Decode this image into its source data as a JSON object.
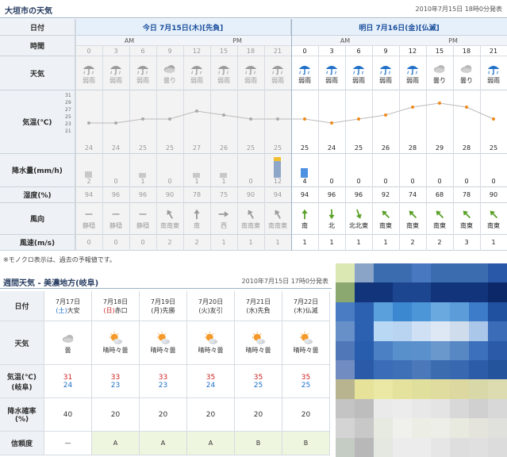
{
  "header": {
    "title": "大垣市の天気",
    "published": "2010年7月15日 18時0分発表"
  },
  "grid": {
    "labels": {
      "date": "日付",
      "time": "時間",
      "weather": "天気",
      "temp": "気温(℃)",
      "precip": "降水量(mm/h)",
      "humidity": "湿度(%)",
      "wind_dir": "風向",
      "wind_speed": "風速(m/s)"
    },
    "today_label": "今日 7月15日(木)[先負]",
    "tomorrow_label": "明日 7月16日(金)[仏滅]",
    "am": "AM",
    "pm": "PM",
    "temp_axis": [
      "31",
      "29",
      "27",
      "25",
      "23",
      "21"
    ],
    "hours": [
      "0",
      "3",
      "6",
      "9",
      "12",
      "15",
      "18",
      "21",
      "0",
      "3",
      "6",
      "9",
      "12",
      "15",
      "18",
      "21"
    ],
    "weather": [
      "弱雨",
      "弱雨",
      "弱雨",
      "曇り",
      "弱雨",
      "弱雨",
      "弱雨",
      "弱雨",
      "弱雨",
      "弱雨",
      "弱雨",
      "弱雨",
      "弱雨",
      "曇り",
      "曇り",
      "弱雨"
    ],
    "temps": [
      "24",
      "24",
      "25",
      "25",
      "27",
      "26",
      "25",
      "25",
      "25",
      "24",
      "25",
      "26",
      "28",
      "29",
      "28",
      "25"
    ],
    "precip": [
      "2",
      "0",
      "1",
      "0",
      "1",
      "1",
      "0",
      "12",
      "4",
      "0",
      "0",
      "0",
      "0",
      "0",
      "0",
      "0"
    ],
    "humidity": [
      "94",
      "96",
      "96",
      "90",
      "78",
      "75",
      "90",
      "94",
      "94",
      "96",
      "96",
      "92",
      "74",
      "68",
      "78",
      "90"
    ],
    "wind_dir": [
      "静穏",
      "静穏",
      "静穏",
      "南南東",
      "南",
      "西",
      "南南東",
      "南南東",
      "南",
      "北",
      "北北東",
      "南東",
      "南東",
      "南東",
      "南東",
      "南東"
    ],
    "wind_speed": [
      "0",
      "0",
      "0",
      "2",
      "2",
      "1",
      "1",
      "1",
      "1",
      "1",
      "1",
      "1",
      "2",
      "2",
      "3",
      "1"
    ],
    "note": "※モノクロ表示は、過去の予報値です。",
    "colors": {
      "past_icon": "#9a9a9a",
      "rain_icon": "#1f6fc8",
      "temp_line": "#f08a1c",
      "precip_bar": "#4d8fe0",
      "precip_peak": "#f0c030"
    }
  },
  "weekly": {
    "title": "週間天気 - 美濃地方(岐阜)",
    "published": "2010年7月15日 17時0分発表",
    "labels": {
      "date": "日付",
      "weather": "天気",
      "temp": "気温(℃)",
      "temp_sub": "(岐阜)",
      "precip": "降水確率",
      "precip_sub": "(%)",
      "reliability": "信頼度"
    },
    "days": [
      {
        "date": "7月17日",
        "wd": "(土)",
        "rokuyo": "大安",
        "weather": "曇",
        "hi": "31",
        "lo": "24",
        "pop": "40",
        "rel": "—"
      },
      {
        "date": "7月18日",
        "wd": "(日)",
        "rokuyo": "赤口",
        "weather": "晴時々曇",
        "hi": "33",
        "lo": "23",
        "pop": "20",
        "rel": "A"
      },
      {
        "date": "7月19日",
        "wd": "(月)",
        "rokuyo": "先勝",
        "weather": "晴時々曇",
        "hi": "33",
        "lo": "23",
        "pop": "20",
        "rel": "A"
      },
      {
        "date": "7月20日",
        "wd": "(火)",
        "rokuyo": "友引",
        "weather": "晴時々曇",
        "hi": "35",
        "lo": "24",
        "pop": "20",
        "rel": "A"
      },
      {
        "date": "7月21日",
        "wd": "(水)",
        "rokuyo": "先負",
        "weather": "晴時々曇",
        "hi": "35",
        "lo": "25",
        "pop": "20",
        "rel": "B"
      },
      {
        "date": "7月22日",
        "wd": "(木)",
        "rokuyo": "仏滅",
        "weather": "晴時々曇",
        "hi": "35",
        "lo": "25",
        "pop": "20",
        "rel": "B"
      }
    ]
  },
  "ad": {
    "colors": [
      "#dce8b4",
      "#8aa4c8",
      "#3c6cb0",
      "#3c6cb0",
      "#4878c0",
      "#3c6cb0",
      "#3c6cb0",
      "#3c6cb0",
      "#2a58a8",
      "#8aa870",
      "#12347a",
      "#12347a",
      "#1c4690",
      "#1c4690",
      "#12347a",
      "#12347a",
      "#12347a",
      "#0c2868",
      "#4a7cc4",
      "#2c60b0",
      "#5aa0dc",
      "#3c88d0",
      "#4c96d8",
      "#6aa8e0",
      "#5c9cd8",
      "#3c7cc8",
      "#2050a0",
      "#6890c8",
      "#2c60b0",
      "#b8d8f4",
      "#b8d4f0",
      "#cfe0f4",
      "#dde8f4",
      "#cfdcec",
      "#aac6e8",
      "#3a6cb8",
      "#5078b8",
      "#285cac",
      "#4c80c4",
      "#5890cc",
      "#5a90cc",
      "#6a98cc",
      "#5888c4",
      "#3c70bc",
      "#2a5aa8",
      "#708cc0",
      "#2a5aa8",
      "#3a6cb8",
      "#3e70b8",
      "#4a78b8",
      "#3c6cb0",
      "#3868b0",
      "#2c5ca8",
      "#24549c",
      "#b8b490",
      "#e6e29a",
      "#eae8a4",
      "#e4e29c",
      "#e0df9c",
      "#e0dca0",
      "#dcd8a0",
      "#d8d8a8",
      "#dcdcb0",
      "#c4c4c4",
      "#bdbdbd",
      "#eaeaea",
      "#ececec",
      "#e8e8e8",
      "#e4e4e4",
      "#d8d8d8",
      "#d0d0d0",
      "#d8d8d8",
      "#d4d4d4",
      "#c8c8c8",
      "#e6eae0",
      "#f0f0ec",
      "#eceee6",
      "#eeeee8",
      "#e8eae0",
      "#e4e4dc",
      "#e0e0dc",
      "#c4ccc4",
      "#b8b8b8",
      "#e4e8e0",
      "#ececec",
      "#ececec",
      "#e6e6e6",
      "#dedede",
      "#e0e0e0",
      "#dcdcdc"
    ]
  }
}
